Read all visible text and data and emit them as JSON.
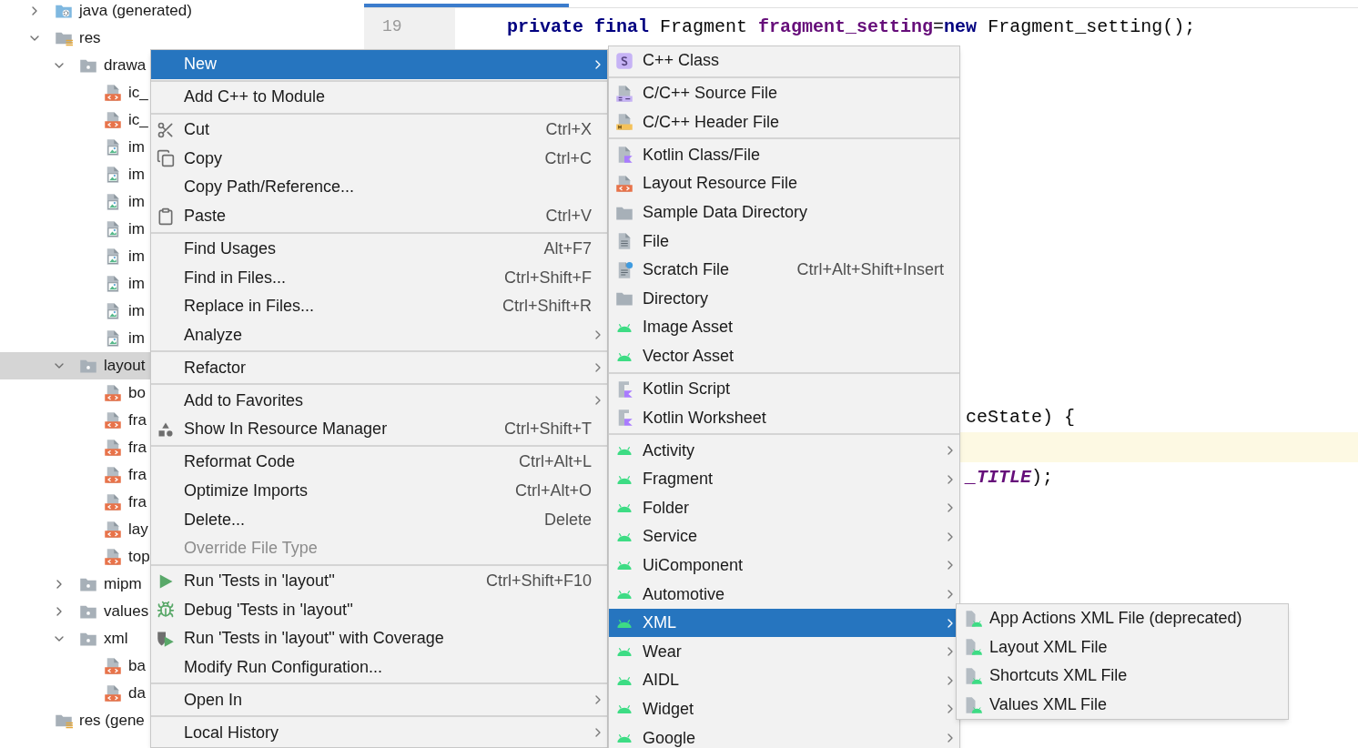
{
  "project_tree": [
    {
      "label": "java (generated)",
      "kind": "gear-folder",
      "expanded": false,
      "selected": false
    },
    {
      "label": "res",
      "kind": "res-folder",
      "expanded": true,
      "selected": false,
      "children": [
        {
          "label": "drawa",
          "kind": "folder",
          "expanded": true,
          "selected": false,
          "children": [
            {
              "label": "ic_",
              "kind": "xml-file",
              "selected": false
            },
            {
              "label": "ic_",
              "kind": "xml-file",
              "selected": false
            },
            {
              "label": "im",
              "kind": "image-file",
              "selected": false
            },
            {
              "label": "im",
              "kind": "image-file",
              "selected": false
            },
            {
              "label": "im",
              "kind": "image-file",
              "selected": false
            },
            {
              "label": "im",
              "kind": "image-file",
              "selected": false
            },
            {
              "label": "im",
              "kind": "image-file",
              "selected": false
            },
            {
              "label": "im",
              "kind": "image-file",
              "selected": false
            },
            {
              "label": "im",
              "kind": "image-file",
              "selected": false
            },
            {
              "label": "im",
              "kind": "image-file",
              "selected": false
            }
          ]
        },
        {
          "label": "layout",
          "kind": "folder",
          "expanded": true,
          "selected": true,
          "children": [
            {
              "label": "bo",
              "kind": "xml-file",
              "selected": false
            },
            {
              "label": "fra",
              "kind": "xml-file",
              "selected": false
            },
            {
              "label": "fra",
              "kind": "xml-file",
              "selected": false
            },
            {
              "label": "fra",
              "kind": "xml-file",
              "selected": false
            },
            {
              "label": "fra",
              "kind": "xml-file",
              "selected": false
            },
            {
              "label": "lay",
              "kind": "xml-file",
              "selected": false
            },
            {
              "label": "top",
              "kind": "xml-file",
              "selected": false
            }
          ]
        },
        {
          "label": "mipm",
          "kind": "folder",
          "expanded": false,
          "selected": false
        },
        {
          "label": "values",
          "kind": "folder",
          "expanded": false,
          "selected": false
        },
        {
          "label": "xml",
          "kind": "folder",
          "expanded": true,
          "selected": false,
          "children": [
            {
              "label": "ba",
              "kind": "xml-file",
              "selected": false
            },
            {
              "label": "da",
              "kind": "xml-file",
              "selected": false
            }
          ]
        }
      ]
    },
    {
      "label": "res (gene",
      "kind": "res-folder",
      "selected": false
    }
  ],
  "editor": {
    "lines": [
      {
        "number": "19",
        "current": false,
        "tokens": [
          {
            "text": "private final",
            "kind": "keyword"
          },
          {
            "text": " Fragment ",
            "kind": "plain"
          },
          {
            "text": "fragment_setting",
            "kind": "field"
          },
          {
            "text": "=",
            "kind": "plain"
          },
          {
            "text": "new",
            "kind": "keyword"
          },
          {
            "text": " Fragment_setting();",
            "kind": "plain"
          }
        ]
      },
      {
        "current": false,
        "tokens": [
          {
            "text": "ceState) {",
            "kind": "plain"
          }
        ]
      },
      {
        "current": true
      },
      {
        "current": false,
        "tokens": [
          {
            "text": "_TITLE",
            "kind": "constant"
          },
          {
            "text": ");",
            "kind": "plain"
          }
        ]
      }
    ]
  },
  "context_menu": {
    "items": [
      {
        "kind": "text",
        "label": "New",
        "submenu": true,
        "selected": true,
        "disabled": false
      },
      {
        "kind": "separator"
      },
      {
        "kind": "text",
        "label": "Add C++ to Module",
        "submenu": false,
        "selected": false,
        "disabled": false
      },
      {
        "kind": "separator"
      },
      {
        "kind": "scissors",
        "label": "Cut",
        "shortcut": "Ctrl+X",
        "submenu": false,
        "selected": false,
        "disabled": false
      },
      {
        "kind": "copy",
        "label": "Copy",
        "shortcut": "Ctrl+C",
        "submenu": false,
        "selected": false,
        "disabled": false
      },
      {
        "kind": "text",
        "label": "Copy Path/Reference...",
        "submenu": false,
        "selected": false,
        "disabled": false
      },
      {
        "kind": "paste",
        "label": "Paste",
        "shortcut": "Ctrl+V",
        "submenu": false,
        "selected": false,
        "disabled": false
      },
      {
        "kind": "separator"
      },
      {
        "kind": "text",
        "label": "Find Usages",
        "shortcut": "Alt+F7",
        "submenu": false,
        "selected": false,
        "disabled": false
      },
      {
        "kind": "text",
        "label": "Find in Files...",
        "shortcut": "Ctrl+Shift+F",
        "submenu": false,
        "selected": false,
        "disabled": false
      },
      {
        "kind": "text",
        "label": "Replace in Files...",
        "shortcut": "Ctrl+Shift+R",
        "submenu": false,
        "selected": false,
        "disabled": false
      },
      {
        "kind": "text",
        "label": "Analyze",
        "submenu": true,
        "selected": false,
        "disabled": false
      },
      {
        "kind": "separator"
      },
      {
        "kind": "text",
        "label": "Refactor",
        "submenu": true,
        "selected": false,
        "disabled": false
      },
      {
        "kind": "separator"
      },
      {
        "kind": "text",
        "label": "Add to Favorites",
        "submenu": true,
        "selected": false,
        "disabled": false
      },
      {
        "kind": "resources",
        "label": "Show In Resource Manager",
        "shortcut": "Ctrl+Shift+T",
        "submenu": false,
        "selected": false,
        "disabled": false
      },
      {
        "kind": "separator"
      },
      {
        "kind": "text",
        "label": "Reformat Code",
        "shortcut": "Ctrl+Alt+L",
        "submenu": false,
        "selected": false,
        "disabled": false
      },
      {
        "kind": "text",
        "label": "Optimize Imports",
        "shortcut": "Ctrl+Alt+O",
        "submenu": false,
        "selected": false,
        "disabled": false
      },
      {
        "kind": "text",
        "label": "Delete...",
        "shortcut": "Delete",
        "submenu": false,
        "selected": false,
        "disabled": false
      },
      {
        "kind": "text",
        "label": "Override File Type",
        "submenu": false,
        "selected": false,
        "disabled": true
      },
      {
        "kind": "separator"
      },
      {
        "kind": "run",
        "label": "Run 'Tests in 'layout''",
        "shortcut": "Ctrl+Shift+F10",
        "submenu": false,
        "selected": false,
        "disabled": false
      },
      {
        "kind": "debug",
        "label": "Debug 'Tests in 'layout''",
        "submenu": false,
        "selected": false,
        "disabled": false
      },
      {
        "kind": "coverage",
        "label": "Run 'Tests in 'layout'' with Coverage",
        "submenu": false,
        "selected": false,
        "disabled": false
      },
      {
        "kind": "text",
        "label": "Modify Run Configuration...",
        "submenu": false,
        "selected": false,
        "disabled": false
      },
      {
        "kind": "separator"
      },
      {
        "kind": "text",
        "label": "Open In",
        "submenu": true,
        "selected": false,
        "disabled": false
      },
      {
        "kind": "separator"
      },
      {
        "kind": "text",
        "label": "Local History",
        "submenu": true,
        "selected": false,
        "disabled": false
      }
    ]
  },
  "new_submenu": {
    "items": [
      {
        "kind": "cpp-class",
        "label": "C++ Class",
        "submenu": false,
        "selected": false
      },
      {
        "kind": "separator"
      },
      {
        "kind": "cpp-source",
        "label": "C/C++ Source File",
        "submenu": false,
        "selected": false
      },
      {
        "kind": "cpp-header",
        "label": "C/C++ Header File",
        "submenu": false,
        "selected": false
      },
      {
        "kind": "separator"
      },
      {
        "kind": "kotlin-file",
        "label": "Kotlin Class/File",
        "submenu": false,
        "selected": false
      },
      {
        "kind": "xml-file",
        "label": "Layout Resource File",
        "submenu": false,
        "selected": false
      },
      {
        "kind": "directory",
        "label": "Sample Data Directory",
        "submenu": false,
        "selected": false
      },
      {
        "kind": "file",
        "label": "File",
        "submenu": false,
        "selected": false
      },
      {
        "kind": "scratch",
        "label": "Scratch File",
        "shortcut": "Ctrl+Alt+Shift+Insert",
        "submenu": false,
        "selected": false
      },
      {
        "kind": "directory",
        "label": "Directory",
        "submenu": false,
        "selected": false
      },
      {
        "kind": "android",
        "label": "Image Asset",
        "submenu": false,
        "selected": false
      },
      {
        "kind": "android",
        "label": "Vector Asset",
        "submenu": false,
        "selected": false
      },
      {
        "kind": "separator"
      },
      {
        "kind": "kotlin-script",
        "label": "Kotlin Script",
        "submenu": false,
        "selected": false
      },
      {
        "kind": "kotlin-script",
        "label": "Kotlin Worksheet",
        "submenu": false,
        "selected": false
      },
      {
        "kind": "separator"
      },
      {
        "kind": "android",
        "label": "Activity",
        "submenu": true,
        "selected": false
      },
      {
        "kind": "android",
        "label": "Fragment",
        "submenu": true,
        "selected": false
      },
      {
        "kind": "android",
        "label": "Folder",
        "submenu": true,
        "selected": false
      },
      {
        "kind": "android",
        "label": "Service",
        "submenu": true,
        "selected": false
      },
      {
        "kind": "android",
        "label": "UiComponent",
        "submenu": true,
        "selected": false
      },
      {
        "kind": "android",
        "label": "Automotive",
        "submenu": true,
        "selected": false
      },
      {
        "kind": "android",
        "label": "XML",
        "submenu": true,
        "selected": true
      },
      {
        "kind": "android",
        "label": "Wear",
        "submenu": true,
        "selected": false
      },
      {
        "kind": "android",
        "label": "AIDL",
        "submenu": true,
        "selected": false
      },
      {
        "kind": "android",
        "label": "Widget",
        "submenu": true,
        "selected": false
      },
      {
        "kind": "android",
        "label": "Google",
        "submenu": true,
        "selected": false
      }
    ]
  },
  "xml_submenu": {
    "items": [
      {
        "kind": "android-file",
        "label": "App Actions XML File (deprecated)",
        "selected": false
      },
      {
        "kind": "android-file",
        "label": "Layout XML File",
        "selected": false
      },
      {
        "kind": "android-file",
        "label": "Shortcuts XML File",
        "selected": false
      },
      {
        "kind": "android-file",
        "label": "Values XML File",
        "selected": false
      }
    ]
  }
}
